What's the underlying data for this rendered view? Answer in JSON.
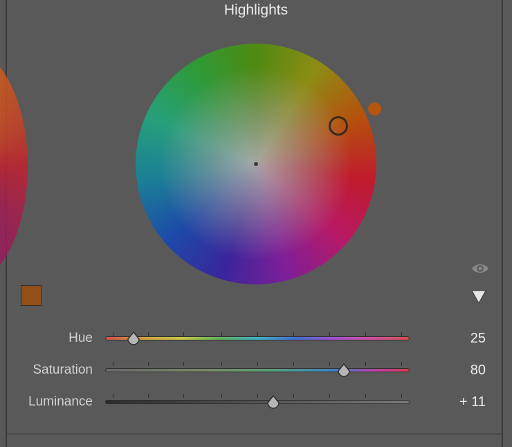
{
  "panel": {
    "title": "Highlights"
  },
  "color_wheel": {
    "selected_hue": 25,
    "selected_saturation": 80
  },
  "swatch": {
    "color": "#925018"
  },
  "sliders": [
    {
      "label": "Hue",
      "value": "25"
    },
    {
      "label": "Saturation",
      "value": "80"
    },
    {
      "label": "Luminance",
      "value": "+ 11"
    }
  ],
  "icons": {
    "visibility": "eye-icon",
    "collapse": "triangle-down-icon"
  },
  "colors": {
    "panel_background": "#595959",
    "marker": "#b5560f"
  }
}
